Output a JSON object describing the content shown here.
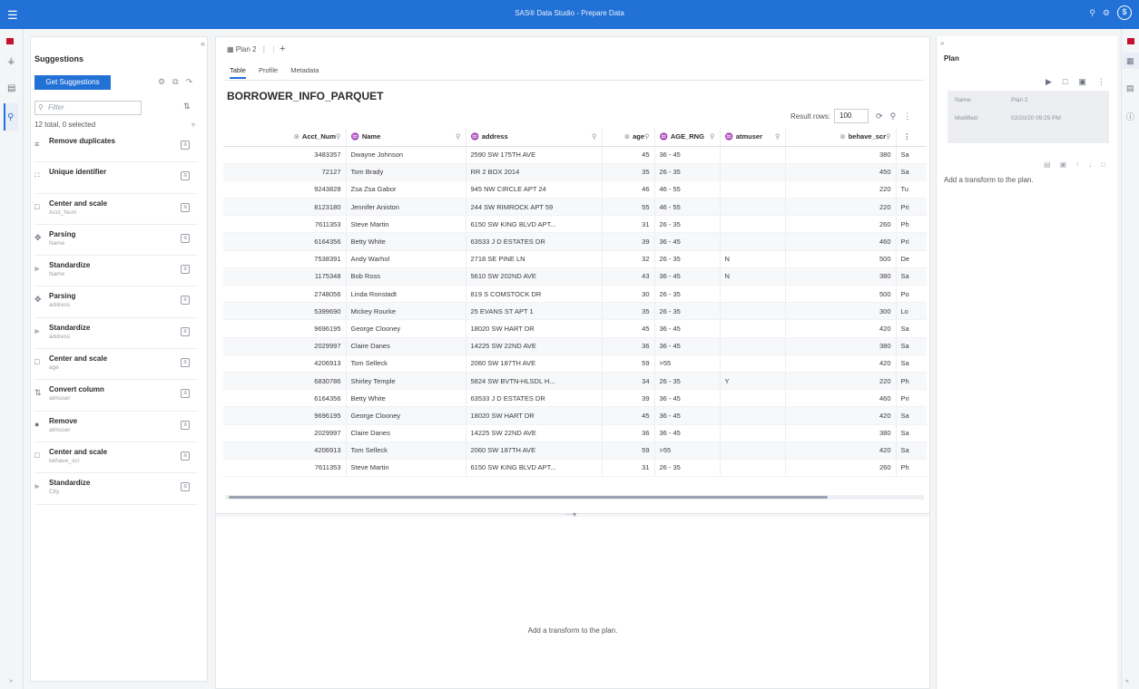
{
  "app": {
    "title": "SAS® Data Studio - Prepare Data"
  },
  "suggestions": {
    "title": "Suggestions",
    "get_button": "Get Suggestions",
    "filter_placeholder": "Filter",
    "count": "12 total, 0 selected",
    "items": [
      {
        "icon": "remove-duplicates-icon",
        "glyph": "≡",
        "name": "Remove duplicates",
        "sub": ""
      },
      {
        "icon": "unique-identifier-icon",
        "glyph": "∷",
        "name": "Unique identifier",
        "sub": ""
      },
      {
        "icon": "center-scale-icon",
        "glyph": "□",
        "name": "Center and scale",
        "sub": "Acct_Num"
      },
      {
        "icon": "parsing-icon",
        "glyph": "✥",
        "name": "Parsing",
        "sub": "Name"
      },
      {
        "icon": "standardize-icon",
        "glyph": "⪢",
        "name": "Standardize",
        "sub": "Name"
      },
      {
        "icon": "parsing-icon",
        "glyph": "✥",
        "name": "Parsing",
        "sub": "address"
      },
      {
        "icon": "standardize-icon",
        "glyph": "⪢",
        "name": "Standardize",
        "sub": "address"
      },
      {
        "icon": "center-scale-icon",
        "glyph": "□",
        "name": "Center and scale",
        "sub": "age"
      },
      {
        "icon": "convert-column-icon",
        "glyph": "⇅",
        "name": "Convert column",
        "sub": "atmuser"
      },
      {
        "icon": "remove-icon",
        "glyph": "●",
        "name": "Remove",
        "sub": "atmuser"
      },
      {
        "icon": "center-scale-icon",
        "glyph": "□",
        "name": "Center and scale",
        "sub": "behave_scr"
      },
      {
        "icon": "standardize-icon",
        "glyph": "⪢",
        "name": "Standardize",
        "sub": "City"
      }
    ]
  },
  "plan_tab": {
    "label": "Plan 2"
  },
  "subtabs": [
    "Table",
    "Profile",
    "Metadata"
  ],
  "dataset": {
    "name": "BORROWER_INFO_PARQUET"
  },
  "result_rows": {
    "label": "Result rows:",
    "value": "100"
  },
  "table": {
    "columns": [
      {
        "name": "Acct_Num",
        "type": "⊗",
        "num": true
      },
      {
        "name": "Name",
        "type": "♒",
        "num": false
      },
      {
        "name": "address",
        "type": "♒",
        "num": false
      },
      {
        "name": "age",
        "type": "⊗",
        "num": true
      },
      {
        "name": "AGE_RNG",
        "type": "♒",
        "num": false
      },
      {
        "name": "atmuser",
        "type": "♒",
        "num": false
      },
      {
        "name": "behave_scr",
        "type": "⊗",
        "num": true
      },
      {
        "name": "",
        "type": "",
        "num": false
      }
    ],
    "rows": [
      [
        "3483357",
        "Dwayne Johnson",
        "2590 SW 175TH AVE",
        "45",
        "36 - 45",
        "",
        "380",
        "Sa"
      ],
      [
        "72127",
        "Tom Brady",
        "RR 2 BOX 2014",
        "35",
        "26 - 35",
        "",
        "450",
        "Sa"
      ],
      [
        "9243828",
        "Zsa Zsa Gabor",
        "945 NW CIRCLE APT 24",
        "46",
        "46 - 55",
        "",
        "220",
        "Tu"
      ],
      [
        "8123180",
        "Jennifer Aniston",
        "244 SW RIMROCK APT 59",
        "55",
        "46 - 55",
        "",
        "220",
        "Pri"
      ],
      [
        "7611353",
        "Steve Martin",
        "6150 SW KING BLVD APT...",
        "31",
        "26 - 35",
        "",
        "260",
        "Ph"
      ],
      [
        "6164356",
        "Betty White",
        "63533 J D ESTATES DR",
        "39",
        "36 - 45",
        "",
        "460",
        "Pri"
      ],
      [
        "7538391",
        "Andy Warhol",
        "2718 SE PINE LN",
        "32",
        "26 - 35",
        "N",
        "500",
        "De"
      ],
      [
        "1175348",
        "Bob Ross",
        "5610 SW 202ND AVE",
        "43",
        "36 - 45",
        "N",
        "380",
        "Sa"
      ],
      [
        "2748056",
        "Linda Ronstadt",
        "819 S COMSTOCK DR",
        "30",
        "26 - 35",
        "",
        "500",
        "Po"
      ],
      [
        "5399690",
        "Mickey Rourke",
        "25 EVANS ST APT 1",
        "35",
        "26 - 35",
        "",
        "300",
        "Lo"
      ],
      [
        "9696195",
        "George Clooney",
        "18020 SW HART DR",
        "45",
        "36 - 45",
        "",
        "420",
        "Sa"
      ],
      [
        "2029997",
        "Claire Danes",
        "14225 SW 22ND AVE",
        "36",
        "36 - 45",
        "",
        "380",
        "Sa"
      ],
      [
        "4206913",
        "Tom Selleck",
        "2060 SW 187TH AVE",
        "59",
        ">55",
        "",
        "420",
        "Sa"
      ],
      [
        "6830786",
        "Shirley Temple",
        "5824 SW BVTN-HLSDL H...",
        "34",
        "26 - 35",
        "Y",
        "220",
        "Ph"
      ],
      [
        "6164356",
        "Betty White",
        "63533 J D ESTATES DR",
        "39",
        "36 - 45",
        "",
        "460",
        "Pri"
      ],
      [
        "9696195",
        "George Clooney",
        "18020 SW HART DR",
        "45",
        "36 - 45",
        "",
        "420",
        "Sa"
      ],
      [
        "2029997",
        "Claire Danes",
        "14225 SW 22ND AVE",
        "36",
        "36 - 45",
        "",
        "380",
        "Sa"
      ],
      [
        "4206913",
        "Tom Selleck",
        "2060 SW 187TH AVE",
        "59",
        ">55",
        "",
        "420",
        "Sa"
      ],
      [
        "7611353",
        "Steve Martin",
        "6150 SW KING BLVD APT...",
        "31",
        "26 - 35",
        "",
        "260",
        "Ph"
      ]
    ]
  },
  "center_empty_msg": "Add a transform to the plan.",
  "plan_panel": {
    "title": "Plan",
    "name_label": "Name:",
    "name_value": "Plan 2",
    "modified_label": "Modified:",
    "modified_value": "02/20/20 09:25 PM",
    "empty_msg": "Add a transform to the plan."
  }
}
